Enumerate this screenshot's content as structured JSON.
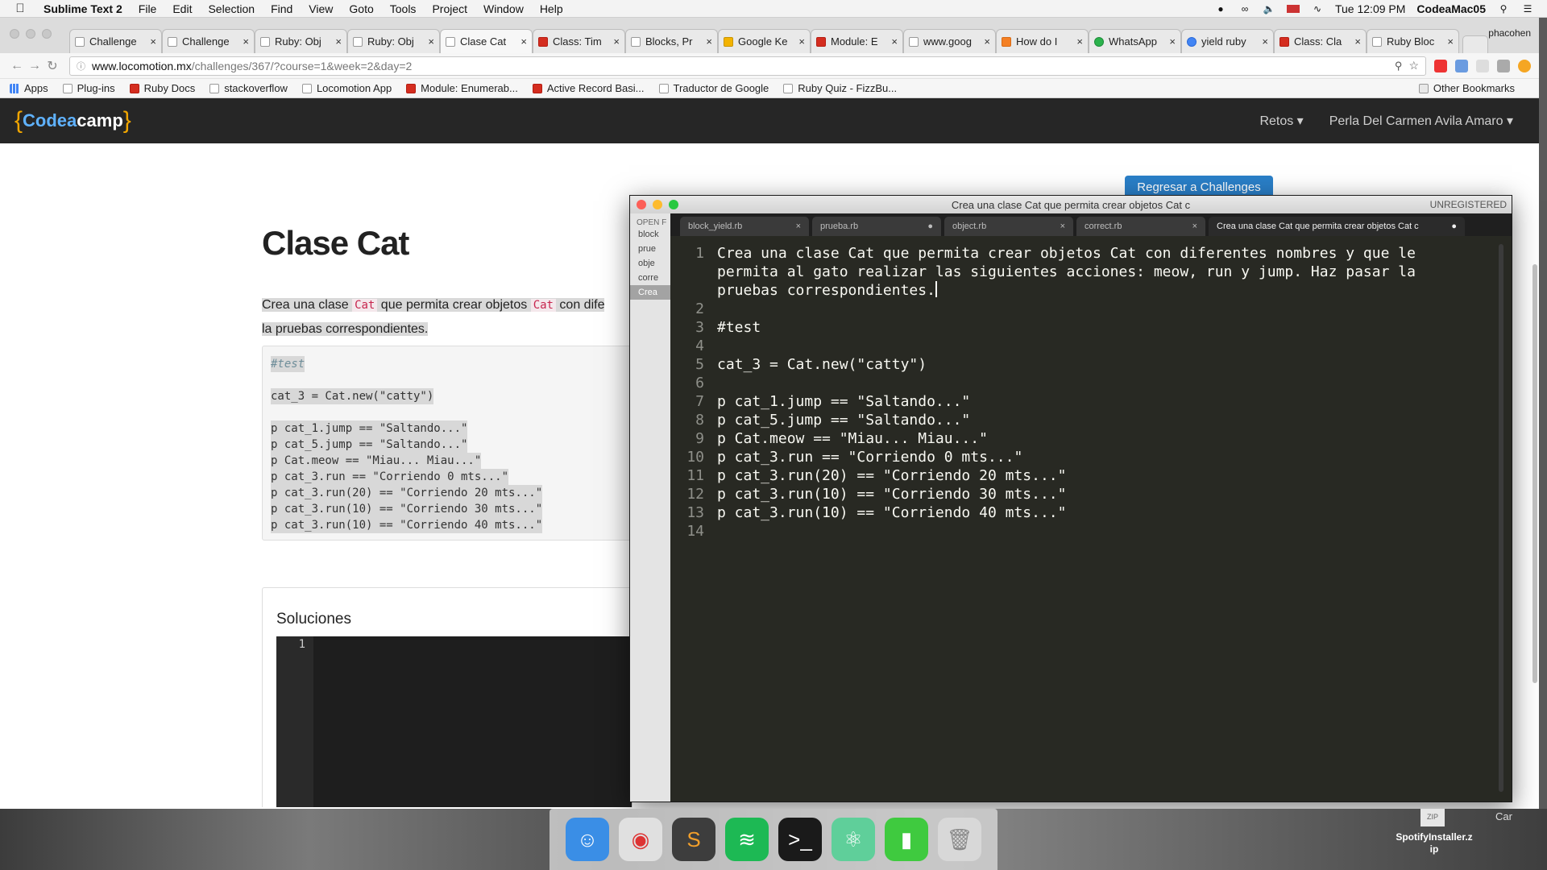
{
  "menubar": {
    "app_name": "Sublime Text 2",
    "items": [
      "File",
      "Edit",
      "Selection",
      "Find",
      "View",
      "Goto",
      "Tools",
      "Project",
      "Window",
      "Help"
    ],
    "clock": "Tue 12:09 PM",
    "computer": "CodeaMac05"
  },
  "browser": {
    "tabs": [
      {
        "label": "Challenge",
        "favicon": "page",
        "active": false
      },
      {
        "label": "Challenge",
        "favicon": "page",
        "active": false
      },
      {
        "label": "Ruby: Obj",
        "favicon": "page",
        "active": false
      },
      {
        "label": "Ruby: Obj",
        "favicon": "page",
        "active": false
      },
      {
        "label": "Clase Cat",
        "favicon": "page",
        "active": true
      },
      {
        "label": "Class: Tim",
        "favicon": "red",
        "active": false
      },
      {
        "label": "Blocks, Pr",
        "favicon": "page",
        "active": false
      },
      {
        "label": "Google Ke",
        "favicon": "yellow",
        "active": false
      },
      {
        "label": "Module: E",
        "favicon": "red",
        "active": false
      },
      {
        "label": "www.goog",
        "favicon": "page",
        "active": false
      },
      {
        "label": "How do I",
        "favicon": "orange",
        "active": false
      },
      {
        "label": "WhatsApp",
        "favicon": "green",
        "active": false
      },
      {
        "label": "yield ruby",
        "favicon": "blue",
        "active": false
      },
      {
        "label": "Class: Cla",
        "favicon": "red",
        "active": false
      },
      {
        "label": "Ruby Bloc",
        "favicon": "page",
        "active": false
      }
    ],
    "profile": "phacohen",
    "url_host": "www.locomotion.mx",
    "url_path": "/challenges/367/?course=1&week=2&day=2",
    "bookmarks": [
      {
        "label": "Apps",
        "icon": "grid"
      },
      {
        "label": "Plug-ins",
        "icon": "page"
      },
      {
        "label": "Ruby Docs",
        "icon": "red"
      },
      {
        "label": "stackoverflow",
        "icon": "page"
      },
      {
        "label": "Locomotion App",
        "icon": "page"
      },
      {
        "label": "Module: Enumerab...",
        "icon": "red"
      },
      {
        "label": "Active Record Basi...",
        "icon": "red"
      },
      {
        "label": "Traductor de Google",
        "icon": "page"
      },
      {
        "label": "Ruby Quiz - FizzBu...",
        "icon": "page"
      }
    ],
    "other_bookmarks": "Other Bookmarks"
  },
  "site": {
    "logo_left": "{",
    "logo_codea": "Codea",
    "logo_camp": "camp",
    "logo_right": "}",
    "nav_retos": "Retos ▾",
    "nav_user": "Perla Del Carmen Avila Amaro ▾",
    "back_button": "Regresar a Challenges",
    "title": "Clase Cat",
    "desc_1": "Crea una clase ",
    "desc_code_1": "Cat",
    "desc_2": " que permita crear objetos ",
    "desc_code_2": "Cat",
    "desc_3": " con dife",
    "desc_4": "la pruebas correspondientes.",
    "code_lines": [
      {
        "t": "#test",
        "kind": "comment"
      },
      {
        "t": "",
        "kind": "plain"
      },
      {
        "t": "cat_3 = Cat.new(\"catty\")",
        "kind": "plain"
      },
      {
        "t": "",
        "kind": "plain"
      },
      {
        "t": "p cat_1.jump == \"Saltando...\"",
        "kind": "plain"
      },
      {
        "t": "p cat_5.jump == \"Saltando...\"",
        "kind": "plain"
      },
      {
        "t": "p Cat.meow == \"Miau... Miau...\"",
        "kind": "plain"
      },
      {
        "t": "p cat_3.run == \"Corriendo 0 mts...\"",
        "kind": "plain"
      },
      {
        "t": "p cat_3.run(20) == \"Corriendo 20 mts...\"",
        "kind": "plain"
      },
      {
        "t": "p cat_3.run(10) == \"Corriendo 30 mts...\"",
        "kind": "plain"
      },
      {
        "t": "p cat_3.run(10) == \"Corriendo 40 mts...\"",
        "kind": "plain"
      }
    ],
    "solutions_title": "Soluciones",
    "solution_line_number": "1"
  },
  "sublime": {
    "window_title": "Crea una clase Cat que permita crear objetos Cat c",
    "unregistered": "UNREGISTERED",
    "sidebar_header": "OPEN F",
    "sidebar_files": [
      "block",
      "prue",
      "obje",
      "corre",
      "Crea"
    ],
    "tabs": [
      {
        "label": "block_yield.rb",
        "mark": "×",
        "active": false
      },
      {
        "label": "prueba.rb",
        "mark": "●",
        "active": false
      },
      {
        "label": "object.rb",
        "mark": "×",
        "active": false
      },
      {
        "label": "correct.rb",
        "mark": "×",
        "active": false
      },
      {
        "label": "Crea una clase Cat que permita crear objetos Cat c",
        "mark": "●",
        "active": true
      }
    ],
    "gutter": [
      "1",
      "",
      "",
      "2",
      "3",
      "4",
      "5",
      "6",
      "7",
      "8",
      "9",
      "10",
      "11",
      "12",
      "13",
      "14"
    ],
    "line1_a": "Crea una clase Cat que permita crear objetos Cat con diferentes nombres y que le",
    "line1_b": "permita al gato realizar las siguientes acciones: meow, run y jump. Haz pasar la",
    "line1_c": "pruebas correspondientes.",
    "lines": [
      "",
      "#test",
      "",
      "cat_3 = Cat.new(\"catty\")",
      "",
      "p cat_1.jump == \"Saltando...\"",
      "p cat_5.jump == \"Saltando...\"",
      "p Cat.meow == \"Miau... Miau...\"",
      "p cat_3.run == \"Corriendo 0 mts...\"",
      "p cat_3.run(20) == \"Corriendo 20 mts...\"",
      "p cat_3.run(10) == \"Corriendo 30 mts...\"",
      "p cat_3.run(10) == \"Corriendo 40 mts...\"",
      ""
    ]
  },
  "dock": {
    "apps": [
      {
        "name": "finder",
        "glyph": "☺",
        "color": "#3a8ee6"
      },
      {
        "name": "chrome",
        "glyph": "◉",
        "color": "#e0e0e0"
      },
      {
        "name": "sublime-text",
        "glyph": "S",
        "color": "#3d3d3d"
      },
      {
        "name": "spotify",
        "glyph": "≋",
        "color": "#1db954"
      },
      {
        "name": "terminal",
        "glyph": ">_",
        "color": "#1a1a1a"
      },
      {
        "name": "atom",
        "glyph": "⚛",
        "color": "#5fcf9a"
      },
      {
        "name": "archive-utility",
        "glyph": "▮",
        "color": "#3fca3f"
      },
      {
        "name": "trash",
        "glyph": "🗑",
        "color": "#d8d8d8"
      }
    ]
  },
  "desktop": {
    "file_name_1": "SpotifyInstaller.z",
    "file_name_2": "ip",
    "file_badge": "ZIP",
    "partial_label": "Car"
  }
}
